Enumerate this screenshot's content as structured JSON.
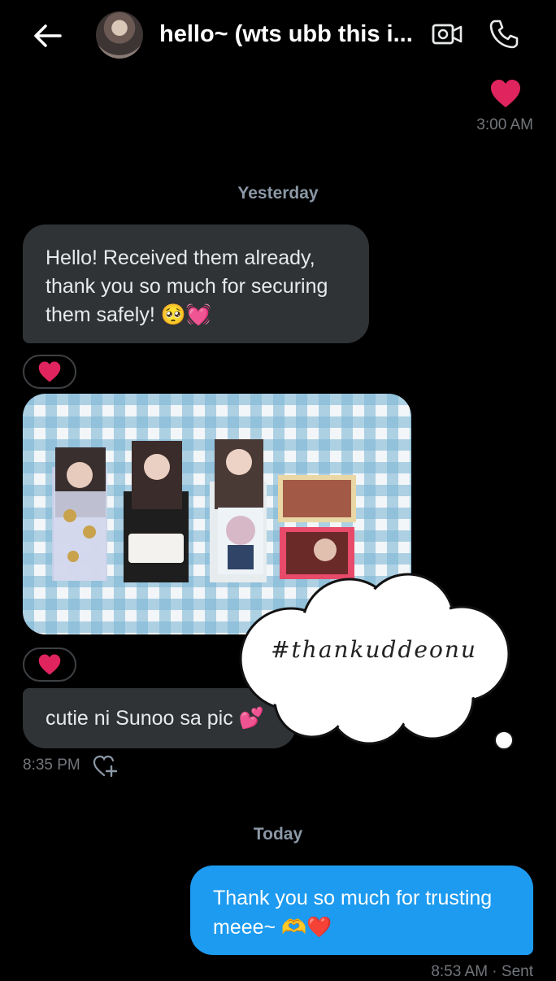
{
  "header": {
    "title": "hello~ (wts ubb this i...",
    "back_icon": "arrow-left-icon",
    "video_icon": "video-camera-icon",
    "phone_icon": "phone-icon"
  },
  "messages": {
    "top_reaction": "❤️",
    "top_time": "3:00 AM",
    "divider_yesterday": "Yesterday",
    "incoming_1": "Hello! Received them already, thank you so much for securing them safely! 🥺💓",
    "reaction_1": "❤️",
    "reaction_2": "❤️",
    "incoming_2": "cutie ni Sunoo sa pic 💕",
    "incoming_time": "8:35 PM",
    "divider_today": "Today",
    "outgoing_1": "Thank you so much for trusting meee~ 🫶❤️",
    "outgoing_status": "8:53 AM · Sent"
  },
  "overlay": {
    "cloud_text": "#thankuddeonu"
  },
  "colors": {
    "background": "#000000",
    "incoming_bubble": "#2f3336",
    "outgoing_bubble": "#1d9bf0",
    "muted_text": "#71767b",
    "heart": "#e0245e"
  }
}
